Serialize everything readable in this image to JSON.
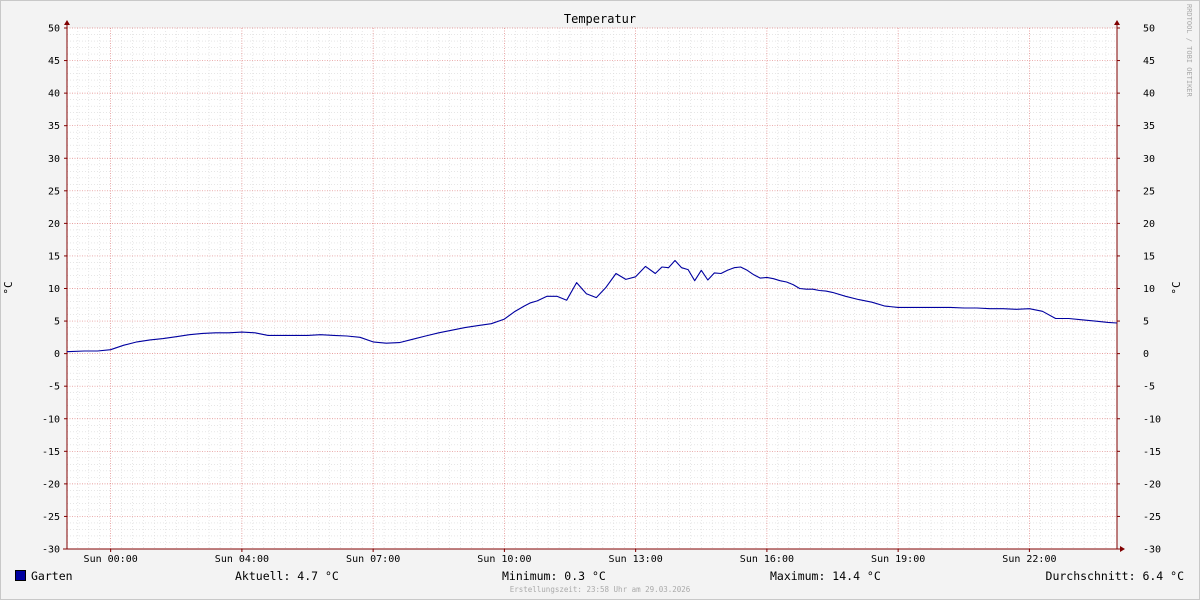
{
  "chart_data": {
    "type": "line",
    "title": "Temperatur",
    "ylabel": "°C",
    "ylabel_right": "°C",
    "ylim": [
      -30,
      50
    ],
    "y_ticks": [
      50,
      45,
      40,
      35,
      30,
      25,
      20,
      15,
      10,
      5,
      0,
      -5,
      -10,
      -15,
      -20,
      -25,
      -30
    ],
    "xlim_hours": [
      -1.33,
      30.67
    ],
    "x_ticks": [
      {
        "label": "Sun 00:00",
        "hour": 0
      },
      {
        "label": "Sun 04:00",
        "hour": 4
      },
      {
        "label": "Sun 07:00",
        "hour": 8
      },
      {
        "label": "Sun 10:00",
        "hour": 12
      },
      {
        "label": "Sun 13:00",
        "hour": 16
      },
      {
        "label": "Sun 16:00",
        "hour": 20
      },
      {
        "label": "Sun 19:00",
        "hour": 24
      },
      {
        "label": "Sun 22:00",
        "hour": 28
      }
    ],
    "grid": true,
    "series": [
      {
        "name": "Garten",
        "color": "#0000a0",
        "x_hours": [
          -1.33,
          -0.8,
          -0.4,
          0,
          0.4,
          0.8,
          1.2,
          1.6,
          2.0,
          2.4,
          2.8,
          3.2,
          3.6,
          4.0,
          4.4,
          4.8,
          5.2,
          5.6,
          6.0,
          6.4,
          6.8,
          7.2,
          7.6,
          8.0,
          8.4,
          8.8,
          9.2,
          9.6,
          10.0,
          10.4,
          10.8,
          11.2,
          11.6,
          12.0,
          12.3,
          12.6,
          12.8,
          13.0,
          13.3,
          13.6,
          13.9,
          14.2,
          14.5,
          14.8,
          15.1,
          15.4,
          15.7,
          16.0,
          16.3,
          16.6,
          16.8,
          17.0,
          17.2,
          17.4,
          17.6,
          17.8,
          18.0,
          18.2,
          18.4,
          18.6,
          18.8,
          19.0,
          19.2,
          19.4,
          19.6,
          19.8,
          20.0,
          20.2,
          20.4,
          20.6,
          20.8,
          21.0,
          21.2,
          21.4,
          21.6,
          21.8,
          22.0,
          22.4,
          22.8,
          23.2,
          23.6,
          24.0,
          24.4,
          24.8,
          25.2,
          25.6,
          26.0,
          26.4,
          26.8,
          27.2,
          27.6,
          28.0,
          28.4,
          28.8,
          29.2,
          29.6,
          30.0,
          30.4,
          30.67
        ],
        "values": [
          0.3,
          0.4,
          0.4,
          0.6,
          1.3,
          1.8,
          2.1,
          2.3,
          2.6,
          2.9,
          3.1,
          3.2,
          3.2,
          3.3,
          3.2,
          2.8,
          2.8,
          2.8,
          2.8,
          2.9,
          2.8,
          2.7,
          2.5,
          1.8,
          1.6,
          1.7,
          2.2,
          2.7,
          3.2,
          3.6,
          4.0,
          4.3,
          4.6,
          5.3,
          6.4,
          7.3,
          7.8,
          8.1,
          8.8,
          8.8,
          8.2,
          10.9,
          9.2,
          8.6,
          10.2,
          12.3,
          11.4,
          11.8,
          13.4,
          12.3,
          13.3,
          13.2,
          14.3,
          13.2,
          12.9,
          11.2,
          12.8,
          11.3,
          12.4,
          12.3,
          12.8,
          13.2,
          13.3,
          12.8,
          12.1,
          11.6,
          11.7,
          11.5,
          11.2,
          11.0,
          10.6,
          10.0,
          9.9,
          9.9,
          9.7,
          9.6,
          9.4,
          8.8,
          8.3,
          7.9,
          7.3,
          7.1,
          7.1,
          7.1,
          7.1,
          7.1,
          7.0,
          7.0,
          6.9,
          6.9,
          6.8,
          6.9,
          6.5,
          5.4,
          5.4,
          5.2,
          5.0,
          4.8,
          4.7
        ]
      }
    ]
  },
  "legend": {
    "series_name": "Garten",
    "aktuell": "Aktuell: 4.7 °C",
    "minimum": "Minimum: 0.3 °C",
    "maximum": "Maximum: 14.4 °C",
    "durchschnitt": "Durchschnitt: 6.4 °C"
  },
  "footer": "Erstellungszeit: 23:58 Uhr am 29.03.2026",
  "watermark": "RRDTOOL / TOBI OETIKER",
  "colors": {
    "line": "#0000a0",
    "major_grid": "#e08080",
    "minor_grid": "#d8d8d8",
    "axis": "#800000",
    "plot_bg": "#ffffff",
    "canvas_bg": "#f3f3f3"
  }
}
